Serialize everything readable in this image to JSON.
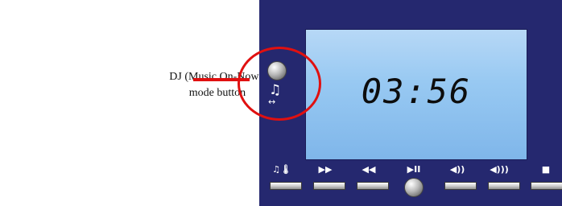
{
  "callout": {
    "label": "DJ (Music On-Now ) mode button"
  },
  "display": {
    "time": "03:56"
  },
  "mode_button": {
    "icon": "music-note-icon",
    "symbol": "♫",
    "arrow": "↔"
  },
  "controls": [
    {
      "name": "music-temp-button",
      "icon": "music-thermometer-icon",
      "symbol": "♫🌡"
    },
    {
      "name": "forward-button",
      "icon": "fast-forward-icon",
      "symbol": "▶▶"
    },
    {
      "name": "rewind-button",
      "icon": "rewind-icon",
      "symbol": "◀◀"
    },
    {
      "name": "play-pause-button",
      "icon": "play-pause-icon",
      "symbol": "▶II"
    },
    {
      "name": "volume-down-button",
      "icon": "volume-down-icon",
      "symbol": "◀))"
    },
    {
      "name": "volume-up-button",
      "icon": "volume-up-icon",
      "symbol": "◀)))"
    },
    {
      "name": "stop-button",
      "icon": "stop-icon",
      "symbol": "■"
    }
  ],
  "colors": {
    "panel": "#25286f",
    "screen": "#98c9f2",
    "highlight": "#e01010"
  }
}
